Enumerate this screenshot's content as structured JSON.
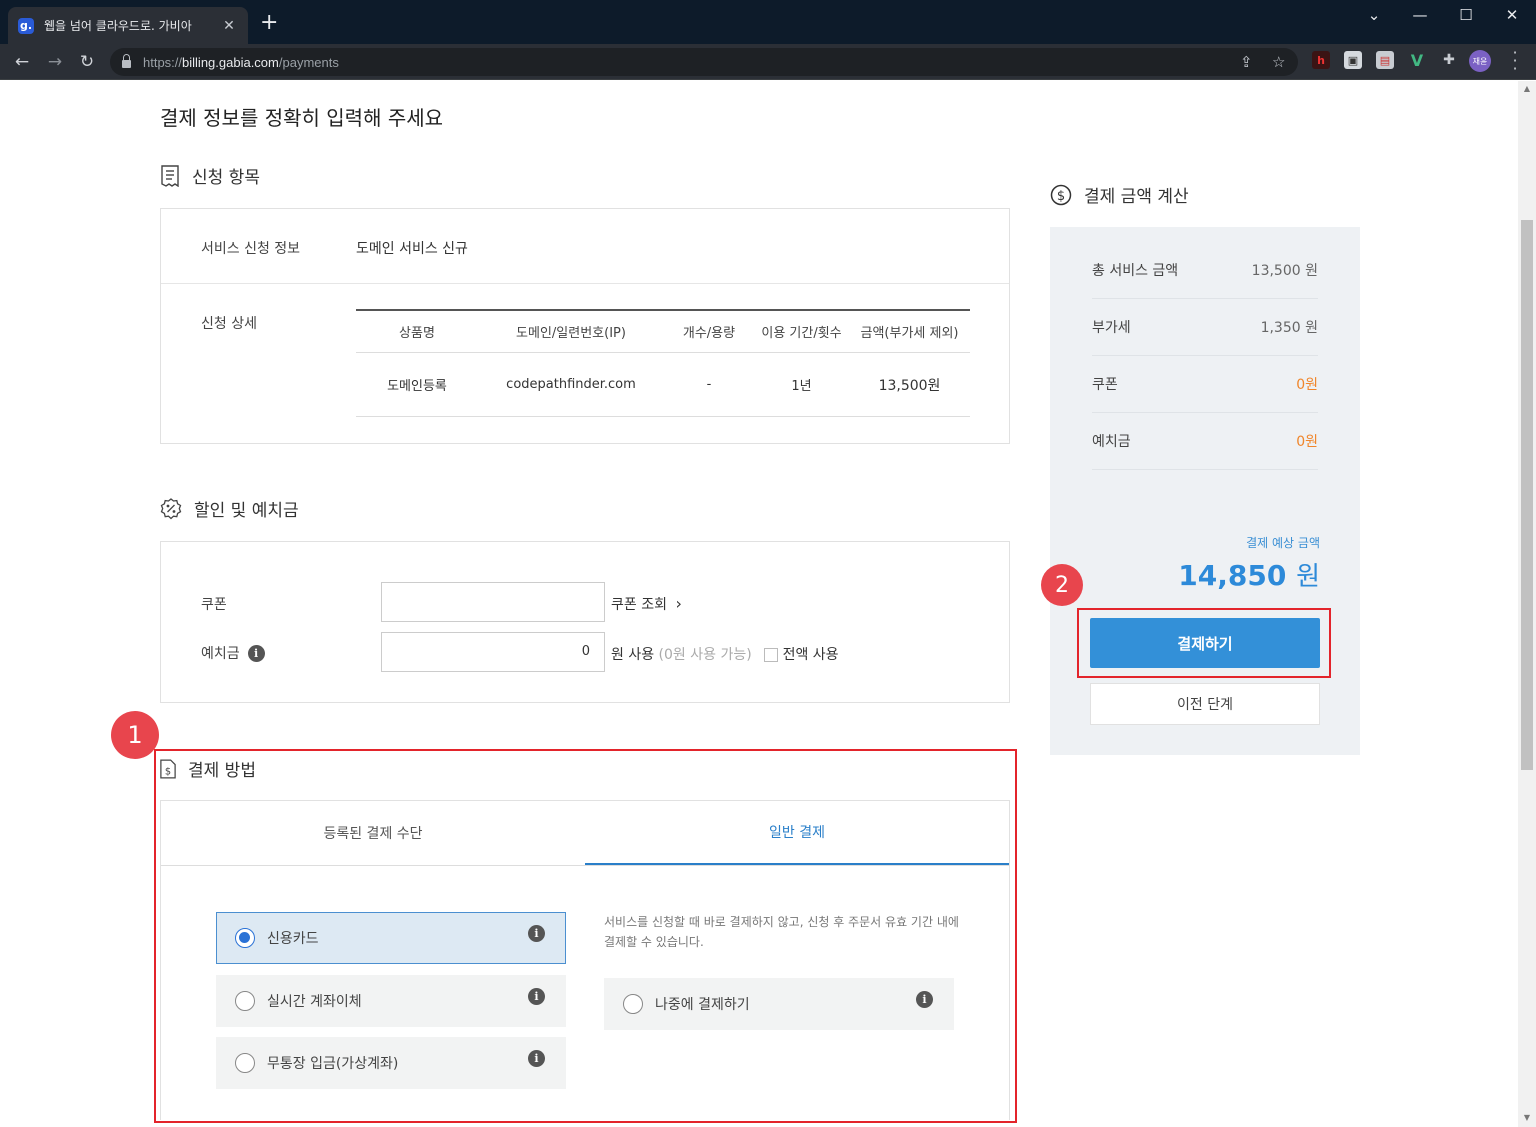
{
  "browser": {
    "tab_title": "웹을 넘어 클라우드로. 가비아",
    "tab_favicon": "g.",
    "url_scheme": "https://",
    "url_host": "billing.gabia.com",
    "url_path": "/payments",
    "avatar_text": "재윤"
  },
  "page": {
    "title": "결제 정보를 정확히 입력해 주세요"
  },
  "application": {
    "heading": "신청 항목",
    "service_label": "서비스 신청 정보",
    "service_value": "도메인 서비스 신규",
    "detail_label": "신청 상세",
    "columns": [
      "상품명",
      "도메인/일련번호(IP)",
      "개수/용량",
      "이용 기간/횟수",
      "금액(부가세 제외)"
    ],
    "rows": [
      [
        "도메인등록",
        "codepathfinder.com",
        "-",
        "1년",
        "13,500원"
      ]
    ]
  },
  "discount": {
    "heading": "할인 및 예치금",
    "coupon_label": "쿠폰",
    "coupon_lookup": "쿠폰 조회",
    "deposit_label": "예치금",
    "deposit_value": "0",
    "deposit_use": "원 사용",
    "deposit_available": "(0원 사용 가능)",
    "use_all": "전액 사용"
  },
  "payment_method": {
    "heading": "결제 방법",
    "badge": "1",
    "tabs": [
      "등록된 결제 수단",
      "일반 결제"
    ],
    "options": [
      "신용카드",
      "실시간 계좌이체",
      "무통장 입금(가상계좌)"
    ],
    "later_note": "서비스를 신청할 때 바로 결제하지 않고, 신청 후 주문서 유효 기간 내에 결제할 수 있습니다.",
    "later_option": "나중에 결제하기"
  },
  "summary": {
    "heading": "결제 금액 계산",
    "rows": [
      {
        "label": "총 서비스 금액",
        "value": "13,500 원"
      },
      {
        "label": "부가세",
        "value": "1,350 원"
      },
      {
        "label": "쿠폰",
        "value": "0원"
      },
      {
        "label": "예치금",
        "value": "0원"
      }
    ],
    "estimate_label": "결제 예상 금액",
    "estimate_amount": "14,850",
    "estimate_unit": "원",
    "pay_button": "결제하기",
    "prev_button": "이전 단계",
    "badge": "2"
  },
  "colors": {
    "accent": "#3390d8",
    "highlight_frame": "#e3242b",
    "orange": "#f0862b"
  }
}
